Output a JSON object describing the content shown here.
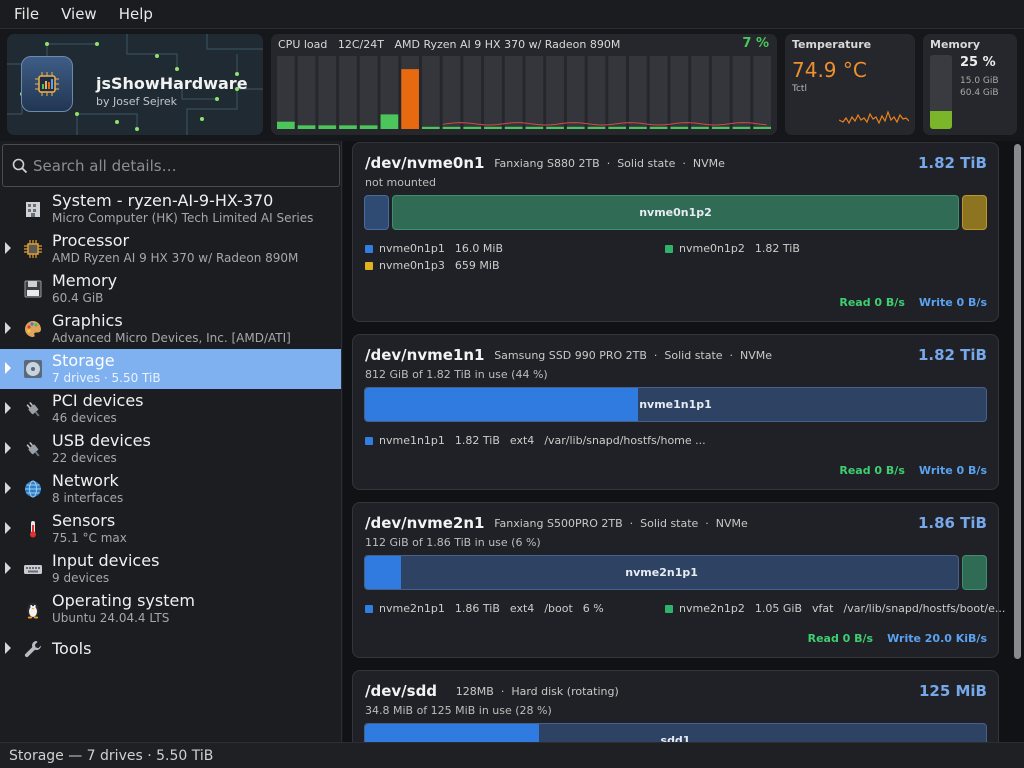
{
  "menu": [
    "File",
    "View",
    "Help"
  ],
  "app": {
    "title": "jsShowHardware",
    "author": "by Josef Sejrek"
  },
  "cpu": {
    "label": "CPU load",
    "threads": "12C/24T",
    "model": "AMD Ryzen AI 9 HX 370 w/ Radeon 890M",
    "percent": "7 %",
    "loads": [
      0.1,
      0.05,
      0.05,
      0.05,
      0.05,
      0.2,
      0.82,
      0.03,
      0.03,
      0.03,
      0.03,
      0.03,
      0.03,
      0.03,
      0.03,
      0.03,
      0.03,
      0.03,
      0.03,
      0.03,
      0.03,
      0.03,
      0.03,
      0.03
    ],
    "colors": {
      "normal": "#4cc65b",
      "hot": "#e86a10",
      "track": "#35363b"
    }
  },
  "temperature": {
    "label": "Temperature",
    "value": "74.9 °C",
    "sensor": "Tctl",
    "color": "#f0902c"
  },
  "memory": {
    "label": "Memory",
    "percent": "25 %",
    "used": "15.0 GiB",
    "total": "60.4 GiB",
    "fill": 0.25
  },
  "search": {
    "placeholder": "Search all details…"
  },
  "tree": [
    {
      "title": "System - ryzen-AI-9-HX-370",
      "sub": "Micro Computer (HK) Tech Limited AI Series",
      "icon": "building-icon",
      "expandable": false
    },
    {
      "title": "Processor",
      "sub": "AMD Ryzen AI 9 HX 370 w/ Radeon 890M",
      "icon": "cpu-chip-icon",
      "expandable": true
    },
    {
      "title": "Memory",
      "sub": "60.4 GiB",
      "icon": "floppy-disk-icon",
      "expandable": false
    },
    {
      "title": "Graphics",
      "sub": "Advanced Micro Devices, Inc. [AMD/ATI]",
      "icon": "palette-icon",
      "expandable": true
    },
    {
      "title": "Storage",
      "sub": "7 drives  ·  5.50 TiB",
      "icon": "optical-disc-icon",
      "expandable": true,
      "selected": true
    },
    {
      "title": "PCI devices",
      "sub": "46 devices",
      "icon": "plug-icon",
      "expandable": true
    },
    {
      "title": "USB devices",
      "sub": "22 devices",
      "icon": "plug-icon",
      "expandable": true
    },
    {
      "title": "Network",
      "sub": "8 interfaces",
      "icon": "globe-icon",
      "expandable": true
    },
    {
      "title": "Sensors",
      "sub": "75.1 °C max",
      "icon": "thermometer-icon",
      "expandable": true
    },
    {
      "title": "Input devices",
      "sub": "9 devices",
      "icon": "keyboard-icon",
      "expandable": true
    },
    {
      "title": "Operating system",
      "sub": "Ubuntu 24.04.4 LTS",
      "icon": "penguin-icon",
      "expandable": false
    },
    {
      "title": "Tools",
      "sub": "",
      "icon": "wrench-icon",
      "expandable": true
    }
  ],
  "disks": [
    {
      "name": "/dev/nvme0n1",
      "model": "Fanxiang S880 2TB",
      "kind": "Solid state",
      "bus": "NVMe",
      "size": "1.82 TiB",
      "usage": "not mounted",
      "segments": [
        {
          "label": "",
          "share": 0.04,
          "color": "#2f4a73",
          "border": "#4a6aa0"
        },
        {
          "label": "nvme0n1p2",
          "share": 0.92,
          "color": "#2f6b55",
          "border": "#3f8f6e"
        },
        {
          "label": "",
          "share": 0.04,
          "color": "#8c7420",
          "border": "#b89a2c"
        }
      ],
      "legend": [
        {
          "swatch": "#2f7ee0",
          "name": "nvme0n1p1",
          "vals": [
            "16.0 MiB"
          ]
        },
        {
          "swatch": "#2fb36b",
          "name": "nvme0n1p2",
          "vals": [
            "1.82 TiB"
          ]
        },
        {
          "swatch": "#e0b220",
          "name": "nvme0n1p3",
          "vals": [
            "659 MiB"
          ]
        }
      ],
      "read": "Read  0 B/s",
      "write": "Write  0 B/s"
    },
    {
      "name": "/dev/nvme1n1",
      "model": "Samsung SSD 990 PRO 2TB",
      "kind": "Solid state",
      "bus": "NVMe",
      "size": "1.82 TiB",
      "usage": "812 GiB of 1.82 TiB in use  (44 %)",
      "used_fraction": 0.44,
      "segments": [
        {
          "label": "nvme1n1p1",
          "share": 1.0,
          "color": "#2e4263",
          "border": "#46608c"
        }
      ],
      "legend": [
        {
          "swatch": "#2f7ee0",
          "name": "nvme1n1p1",
          "vals": [
            "1.82 TiB",
            "ext4",
            "/var/lib/snapd/hostfs/home ..."
          ]
        }
      ],
      "read": "Read  0 B/s",
      "write": "Write  0 B/s"
    },
    {
      "name": "/dev/nvme2n1",
      "model": "Fanxiang S500PRO 2TB",
      "kind": "Solid state",
      "bus": "NVMe",
      "size": "1.86 TiB",
      "usage": "112 GiB of 1.86 TiB in use  (6 %)",
      "used_fraction": 0.06,
      "segments": [
        {
          "label": "nvme2n1p1",
          "share": 0.96,
          "color": "#2e4263",
          "border": "#46608c"
        },
        {
          "label": "",
          "share": 0.04,
          "color": "#2f6b55",
          "border": "#3f8f6e"
        }
      ],
      "legend": [
        {
          "swatch": "#2f7ee0",
          "name": "nvme2n1p1",
          "vals": [
            "1.86 TiB",
            "ext4",
            "/boot",
            "6 %"
          ]
        },
        {
          "swatch": "#2fb36b",
          "name": "nvme2n1p2",
          "vals": [
            "1.05 GiB",
            "vfat",
            "/var/lib/snapd/hostfs/boot/e..."
          ]
        }
      ],
      "read": "Read  0 B/s",
      "write": "Write  20.0 KiB/s"
    },
    {
      "name": "/dev/sdd",
      "model": "128MB",
      "kind": "Hard disk (rotating)",
      "bus": "",
      "size": "125 MiB",
      "usage": "34.8 MiB of 125 MiB in use  (28 %)",
      "used_fraction": 0.28,
      "segments": [
        {
          "label": "sdd1",
          "share": 1.0,
          "color": "#2e4263",
          "border": "#46608c"
        }
      ],
      "legend": [],
      "read": "",
      "write": ""
    }
  ],
  "status": "Storage  —  7 drives  ·  5.50 TiB",
  "colors": {
    "used": "#2f7be0",
    "selection": "#7fb1f1",
    "read": "#3fcf70",
    "write": "#5aa2f0",
    "accent": "#76a8ea"
  }
}
